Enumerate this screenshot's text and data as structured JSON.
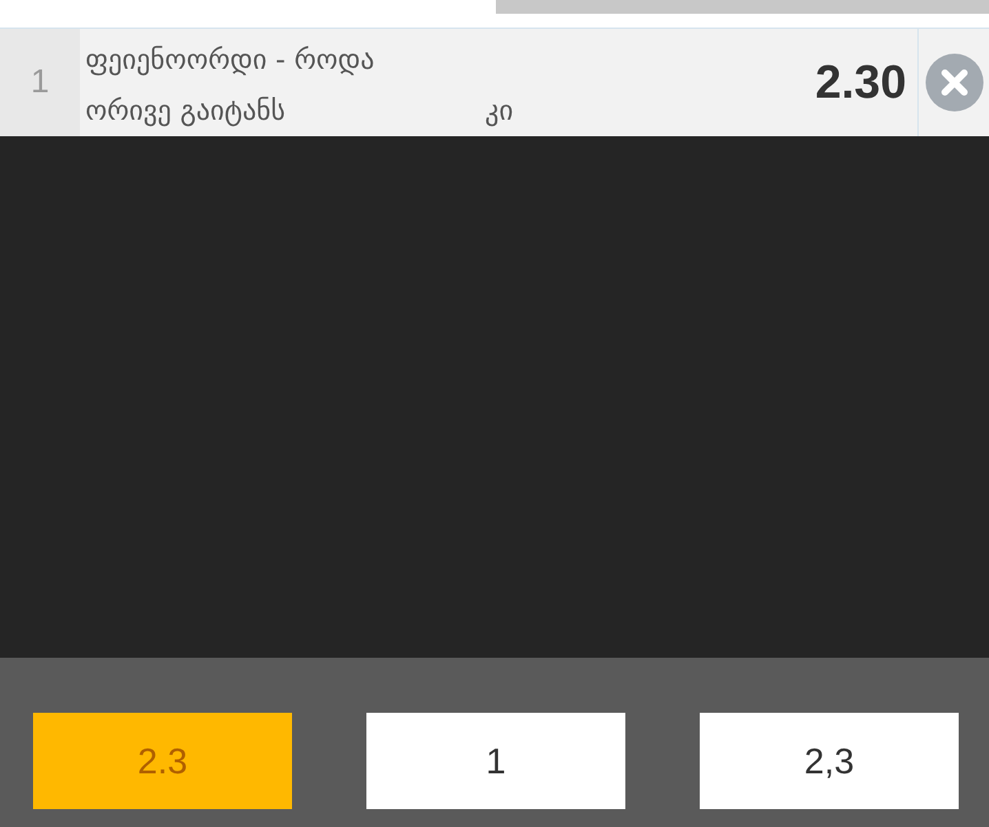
{
  "bet": {
    "number": "1",
    "event": "ფეიენოორდი - როდა",
    "market": "ორივე გაიტანს",
    "outcome": "კი",
    "odds": "2.30"
  },
  "keypad": [
    {
      "label": "2.3",
      "selected": true
    },
    {
      "label": "1",
      "selected": false
    },
    {
      "label": "2,3",
      "selected": false
    }
  ]
}
